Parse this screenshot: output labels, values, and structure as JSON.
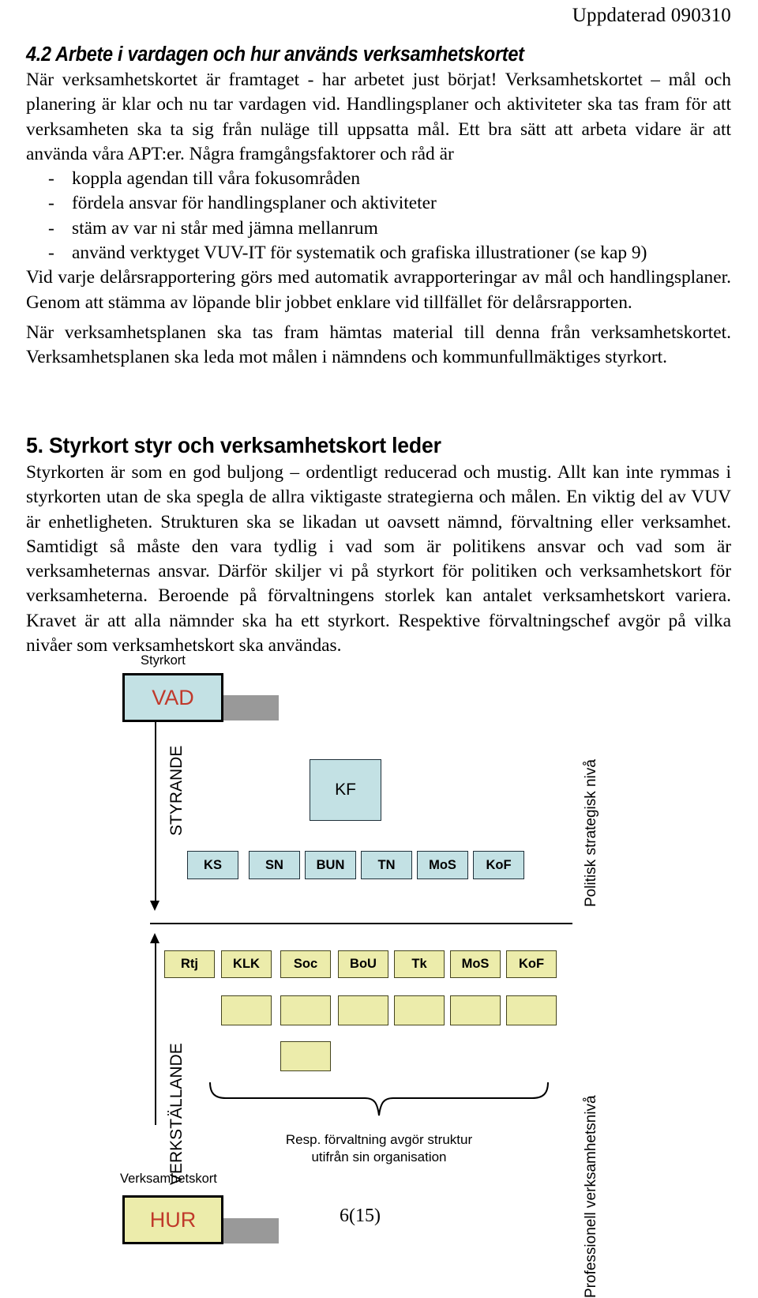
{
  "header": {
    "updated": "Uppdaterad 090310"
  },
  "section_4_2": {
    "heading": "4.2 Arbete i vardagen och hur används verksamhetskortet",
    "paragraph_1": "När verksamhetskortet är framtaget  - har arbetet just börjat! Verksamhetskortet – mål och planering är klar och nu tar vardagen vid. Handlingsplaner och aktiviteter ska tas fram för att verksamheten ska ta sig från nuläge till uppsatta mål. Ett bra sätt att arbeta vidare är att använda våra APT:er. Några framgångsfaktorer och råd är",
    "bullet_marker": "-",
    "bullets": [
      "koppla agendan till våra fokusområden",
      "fördela ansvar för handlingsplaner och aktiviteter",
      "stäm av var ni står med jämna mellanrum",
      "använd verktyget VUV-IT för systematik och grafiska illustrationer (se kap 9)"
    ],
    "paragraph_2": "Vid varje delårsrapportering görs med automatik  avrapporteringar av mål och handlingsplaner. Genom att stämma av löpande blir jobbet enklare vid tillfället för delårsrapporten.",
    "paragraph_3": "När verksamhetsplanen ska tas fram hämtas material till denna från verksamhetskortet. Verksamhetsplanen ska leda mot målen i nämndens och kommunfullmäktiges styrkort."
  },
  "section_5": {
    "heading": "5. Styrkort styr och verksamhetskort leder",
    "paragraph_1": "Styrkorten är som en god buljong – ordentligt reducerad och mustig. Allt kan inte rymmas i styrkorten utan de ska spegla de allra viktigaste strategierna och målen. En viktig del av VUV är enhetligheten. Strukturen ska se likadan ut oavsett nämnd, förvaltning eller verksamhet. Samtidigt så måste den vara tydlig i vad som är politikens ansvar och vad som är verksamheternas ansvar. Därför skiljer vi på styrkort för politiken och verksamhetskort för verksamheterna. Beroende på förvaltningens storlek kan antalet verksamhetskort variera. Kravet är att alla nämnder ska ha ett styrkort. Respektive förvaltningschef avgör på vilka nivåer som verksamhetskort ska användas."
  },
  "diagram": {
    "styrkort_label": "Styrkort",
    "vad_box": "VAD",
    "verksamhetskort_label": "Verksamhetskort",
    "hur_box": "HUR",
    "left_axis_top": "STYRANDE",
    "left_axis_bottom": "VERKSTÄLLANDE",
    "right_axis_top": "Politisk strategisk nivå",
    "right_axis_bottom": "Professionell verksamhetsnivå",
    "kf_box": "KF",
    "political_row": [
      "KS",
      "SN",
      "BUN",
      "TN",
      "MoS",
      "KoF"
    ],
    "operational_row": [
      "Rtj",
      "KLK",
      "Soc",
      "BoU",
      "Tk",
      "MoS",
      "KoF"
    ],
    "empty_row_count": 6,
    "extra_empty_box_count": 1,
    "brace_caption": "Resp. förvaltning avgör struktur\nutifrån sin organisation",
    "colors": {
      "political_fill": "#c3e1e4",
      "operational_fill": "#ececab",
      "shadow": "#999999",
      "accent_text": "#c0392b"
    }
  },
  "footer": {
    "page_number": "6(15)"
  }
}
